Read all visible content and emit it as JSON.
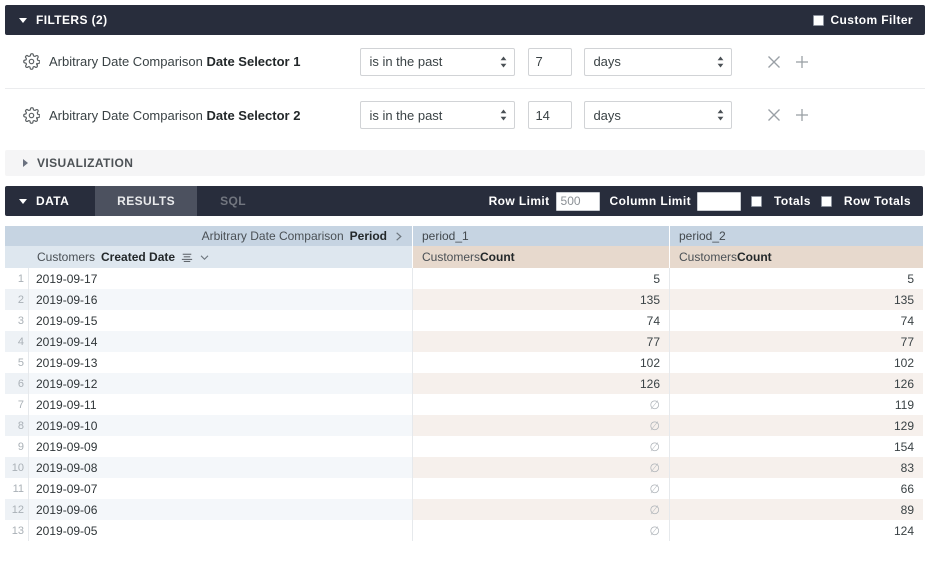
{
  "filters": {
    "section_label": "FILTERS (2)",
    "custom_filter_label": "Custom Filter",
    "custom_filter_checked": false,
    "rows": [
      {
        "prefix": "Arbitrary Date Comparison ",
        "field": "Date Selector 1",
        "condition": "is in the past",
        "amount": "7",
        "unit": "days"
      },
      {
        "prefix": "Arbitrary Date Comparison ",
        "field": "Date Selector 2",
        "condition": "is in the past",
        "amount": "14",
        "unit": "days"
      }
    ]
  },
  "visualization": {
    "section_label": "VISUALIZATION"
  },
  "data_section": {
    "section_label": "DATA",
    "tabs": [
      {
        "label": "RESULTS",
        "active": true
      },
      {
        "label": "SQL",
        "active": false
      }
    ],
    "row_limit_label": "Row Limit",
    "row_limit_value": "500",
    "column_limit_label": "Column Limit",
    "column_limit_value": "",
    "totals_label": "Totals",
    "totals_checked": false,
    "row_totals_label": "Row Totals",
    "row_totals_checked": false
  },
  "table": {
    "header_top": {
      "dim_view": "Arbitrary Date Comparison ",
      "dim_field": "Period",
      "col1": "period_1",
      "col2": "period_2"
    },
    "header_sub": {
      "dim_view": "Customers ",
      "dim_field": "Created Date",
      "m1_view": "Customers ",
      "m1_field": "Count",
      "m2_view": "Customers ",
      "m2_field": "Count"
    },
    "null_symbol": "∅",
    "rows": [
      {
        "n": "1",
        "date": "2019-09-17",
        "period_1": "5",
        "period_2": "5"
      },
      {
        "n": "2",
        "date": "2019-09-16",
        "period_1": "135",
        "period_2": "135"
      },
      {
        "n": "3",
        "date": "2019-09-15",
        "period_1": "74",
        "period_2": "74"
      },
      {
        "n": "4",
        "date": "2019-09-14",
        "period_1": "77",
        "period_2": "77"
      },
      {
        "n": "5",
        "date": "2019-09-13",
        "period_1": "102",
        "period_2": "102"
      },
      {
        "n": "6",
        "date": "2019-09-12",
        "period_1": "126",
        "period_2": "126"
      },
      {
        "n": "7",
        "date": "2019-09-11",
        "period_1": "∅",
        "period_2": "119"
      },
      {
        "n": "8",
        "date": "2019-09-10",
        "period_1": "∅",
        "period_2": "129"
      },
      {
        "n": "9",
        "date": "2019-09-09",
        "period_1": "∅",
        "period_2": "154"
      },
      {
        "n": "10",
        "date": "2019-09-08",
        "period_1": "∅",
        "period_2": "83"
      },
      {
        "n": "11",
        "date": "2019-09-07",
        "period_1": "∅",
        "period_2": "66"
      },
      {
        "n": "12",
        "date": "2019-09-06",
        "period_1": "∅",
        "period_2": "89"
      },
      {
        "n": "13",
        "date": "2019-09-05",
        "period_1": "∅",
        "period_2": "124"
      }
    ]
  },
  "colors": {
    "dark_bar": "#282d3c",
    "tab_active": "#4c515f",
    "header_top": "#c6d4e2",
    "header_sub_dim": "#dee7ef",
    "header_sub_measure": "#e7d9cd",
    "row_even_dim": "#f4f7fa",
    "row_even_measure": "#f6f0ec"
  }
}
